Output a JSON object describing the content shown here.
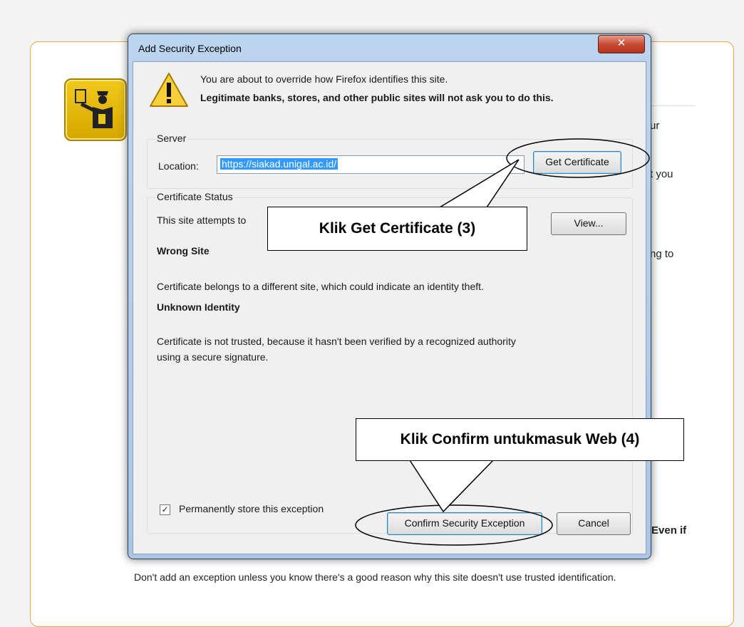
{
  "background": {
    "fragments": [
      "ur",
      "t you",
      "ng to",
      "Even if"
    ],
    "footer_text": "Don't add an exception unless you know there's a good reason why this site doesn't use trusted identification."
  },
  "dialog": {
    "title": "Add Security Exception",
    "close_icon": "close-icon",
    "warning_line1": "You are about to override how Firefox identifies this site.",
    "warning_line2": "Legitimate banks, stores, and other public sites will not ask you to do this.",
    "server": {
      "group_label": "Server",
      "location_label": "Location:",
      "location_value": "https://siakad.unigal.ac.id/",
      "get_certificate_label": "Get Certificate"
    },
    "certificate_status": {
      "group_label": "Certificate Status",
      "intro": "This site attempts to",
      "view_label": "View...",
      "wrong_site_heading": "Wrong Site",
      "wrong_site_text": "Certificate belongs to a different site, which could indicate an identity theft.",
      "unknown_identity_heading": "Unknown Identity",
      "unknown_identity_text_1": "Certificate is not trusted, because it hasn't been verified by a recognized authority",
      "unknown_identity_text_2": "using a secure signature."
    },
    "permanently_store_label": "Permanently store this exception",
    "permanently_store_checked": true,
    "confirm_label": "Confirm Security Exception",
    "cancel_label": "Cancel"
  },
  "annotations": {
    "callout_get_certificate": "Klik Get Certificate (3)",
    "callout_confirm": "Klik Confirm untukmasuk Web (4)"
  }
}
